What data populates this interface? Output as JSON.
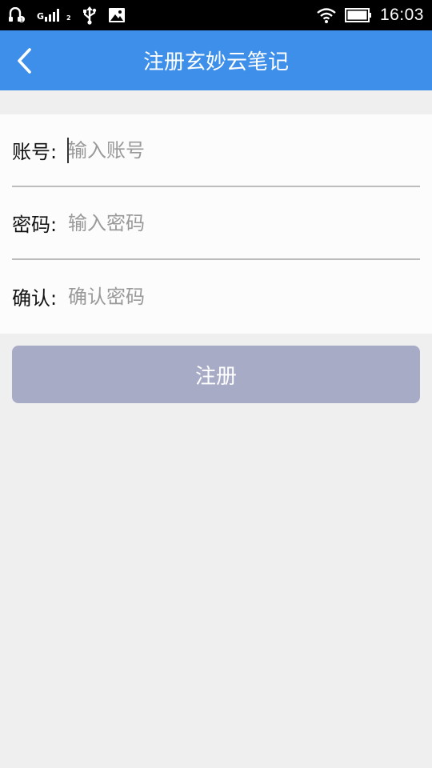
{
  "status_bar": {
    "network_label": "G",
    "sim_index": "2",
    "time": "16:03",
    "icons": [
      "notification-app-icon",
      "signal-icon",
      "usb-icon",
      "image-icon",
      "wifi-icon",
      "battery-icon"
    ]
  },
  "app_bar": {
    "title": "注册玄妙云笔记",
    "back_icon": "chevron-left-icon"
  },
  "form": {
    "account": {
      "label": "账号:",
      "placeholder": "输入账号",
      "value": ""
    },
    "password": {
      "label": "密码:",
      "placeholder": "输入密码",
      "value": ""
    },
    "confirm": {
      "label": "确认:",
      "placeholder": "确认密码",
      "value": ""
    }
  },
  "submit": {
    "label": "注册"
  },
  "colors": {
    "app_bar": "#3d8fea",
    "button_disabled": "#a7abc6",
    "background": "#efefef",
    "divider": "#bcbcbc"
  }
}
